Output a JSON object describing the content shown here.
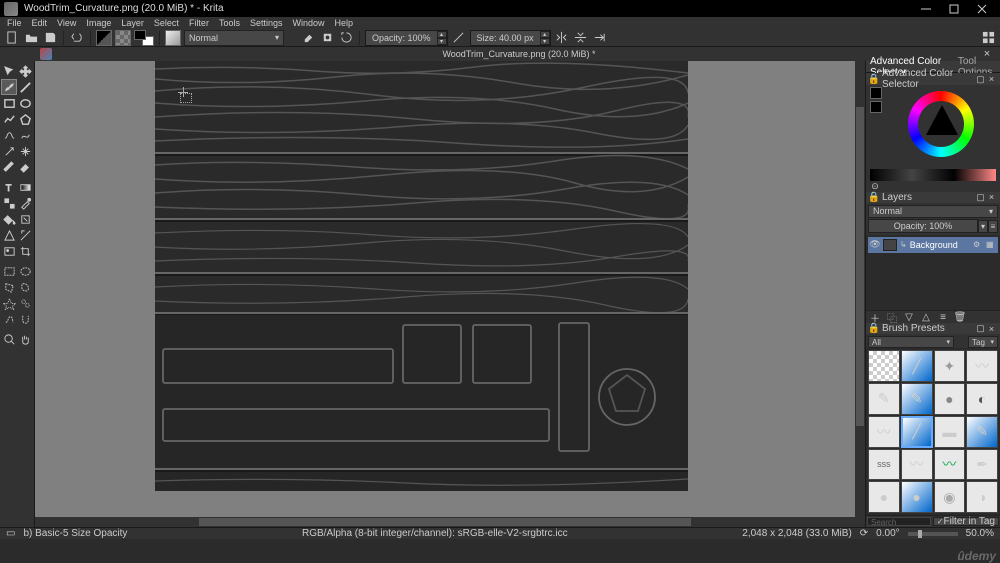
{
  "titlebar": {
    "title": "WoodTrim_Curvature.png (20.0 MiB) * - Krita"
  },
  "menubar": {
    "items": [
      "File",
      "Edit",
      "View",
      "Image",
      "Layer",
      "Select",
      "Filter",
      "Tools",
      "Settings",
      "Window",
      "Help"
    ]
  },
  "toolbar": {
    "blend_mode": "Normal",
    "opacity_label": "Opacity: 100%",
    "size_label": "Size: 40.00 px"
  },
  "doctab": {
    "title": "WoodTrim_Curvature.png (20.0 MiB) *"
  },
  "rightpanel": {
    "tab_color": "Advanced Color Selector",
    "tab_tool": "Tool Options",
    "colorsel_title": "Advanced Color Selector",
    "layers_title": "Layers",
    "layer_mode": "Normal",
    "layer_opacity": "Opacity: 100%",
    "layer_name": "Background",
    "brush_title": "Brush Presets",
    "brush_filter_all": "All",
    "brush_filter_tag": "Tag",
    "search_placeholder": "Search",
    "filter_tag_label": "Filter in Tag"
  },
  "statusbar": {
    "brush_info": "b) Basic-5 Size Opacity",
    "colorspace": "RGB/Alpha (8-bit integer/channel): sRGB-elle-V2-srgbtrc.icc",
    "dimensions": "2,048 x 2,048 (33.0 MiB)",
    "rotation": "0.00°",
    "zoom": "50.0%"
  },
  "watermark": "ûdemy"
}
